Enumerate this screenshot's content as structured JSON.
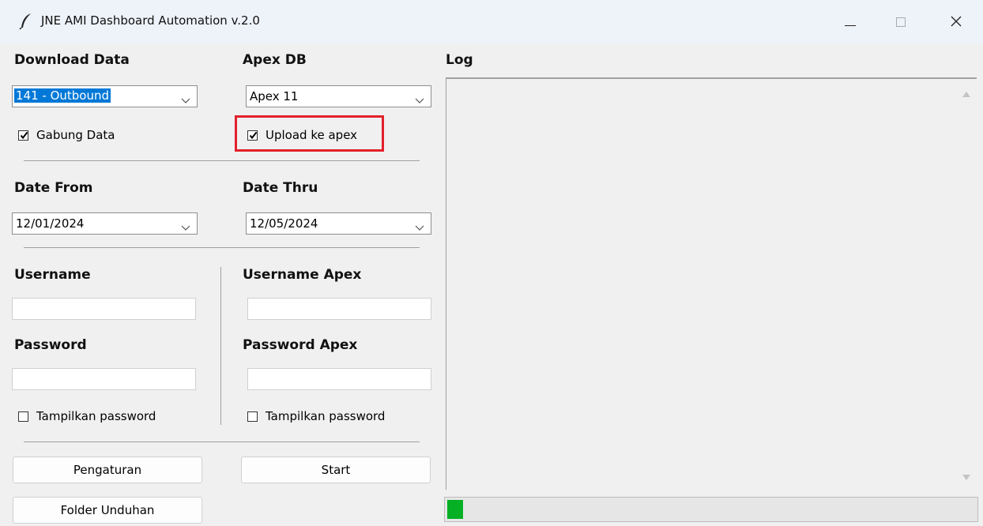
{
  "window": {
    "title": "JNE AMI Dashboard Automation v.2.0"
  },
  "download": {
    "label": "Download Data",
    "selected": "141 - Outbound",
    "gabung_label": "Gabung Data",
    "gabung_checked": true
  },
  "apex": {
    "label": "Apex DB",
    "selected": "Apex 11",
    "upload_label": "Upload ke apex",
    "upload_checked": true
  },
  "dates": {
    "from_label": "Date From",
    "from_value": "12/01/2024",
    "thru_label": "Date Thru",
    "thru_value": "12/05/2024"
  },
  "credentials": {
    "username_label": "Username",
    "username_value": "",
    "password_label": "Password",
    "password_value": "",
    "show_password_label": "Tampilkan password",
    "show_password_checked": false,
    "username_apex_label": "Username Apex",
    "username_apex_value": "",
    "password_apex_label": "Password Apex",
    "password_apex_value": "",
    "show_password_apex_label": "Tampilkan password",
    "show_password_apex_checked": false
  },
  "buttons": {
    "settings": "Pengaturan",
    "start": "Start",
    "download_folder": "Folder Unduhan"
  },
  "log": {
    "label": "Log",
    "content": ""
  },
  "progress": {
    "fraction": 0.03
  },
  "colors": {
    "highlight": "#e3202a",
    "progress_fill": "#06b025",
    "selection": "#0078d7"
  },
  "icons": {
    "app": "feather-icon",
    "minimize": "minimize-icon",
    "maximize": "maximize-icon",
    "close": "close-icon",
    "dropdown": "chevron-down-icon",
    "check": "checkmark-icon"
  }
}
